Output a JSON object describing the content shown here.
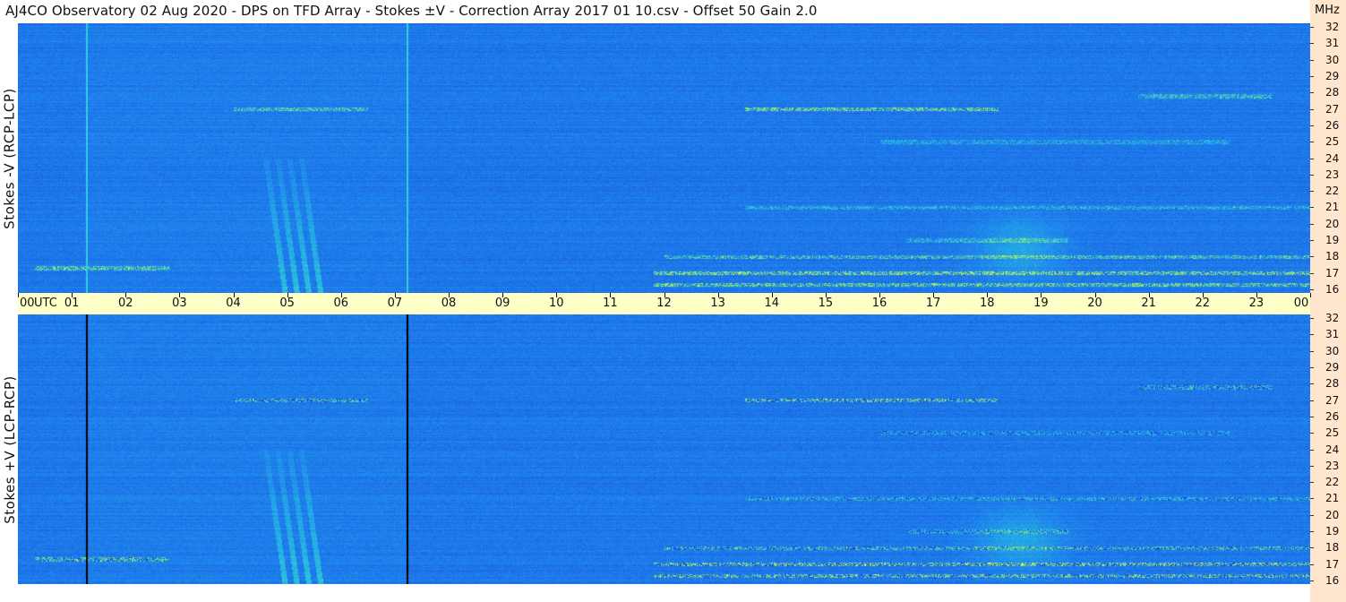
{
  "title": "AJ4CO Observatory  02 Aug 2020  -  DPS on TFD Array  -  Stokes ±V  -  Correction Array 2017 01 10.csv  -  Offset 50  Gain 2.0",
  "axis": {
    "utc_label": "UTC",
    "mhz_label": "MHz"
  },
  "panels": [
    {
      "ylabel": "Stokes -V (RCP-LCP)"
    },
    {
      "ylabel": "Stokes +V (LCP-RCP)"
    }
  ],
  "chart_data": [
    {
      "type": "heatmap",
      "title": "AJ4CO Observatory  02 Aug 2020  -  DPS on TFD Array  -  Stokes ±V  -  Correction Array 2017 01 10.csv  -  Offset 50  Gain 2.0",
      "ylabel": "Stokes -V (RCP-LCP)",
      "xlabel": "UTC",
      "x_ticks": [
        "00",
        "01",
        "02",
        "03",
        "04",
        "05",
        "06",
        "07",
        "08",
        "09",
        "10",
        "11",
        "12",
        "13",
        "14",
        "15",
        "16",
        "17",
        "18",
        "19",
        "20",
        "21",
        "22",
        "23",
        "00"
      ],
      "xlim": [
        0,
        24
      ],
      "y_unit": "MHz",
      "y_ticks": [
        16,
        17,
        18,
        19,
        20,
        21,
        22,
        23,
        24,
        25,
        26,
        27,
        28,
        29,
        30,
        31,
        32
      ],
      "ylim": [
        16,
        32
      ],
      "colormap": [
        "#1a3fcc",
        "#1e7fee",
        "#28c0e0",
        "#a0f060",
        "#f0f040"
      ]
    },
    {
      "type": "heatmap",
      "ylabel": "Stokes +V (LCP-RCP)",
      "xlabel": "UTC",
      "x_ticks": [
        "00",
        "01",
        "02",
        "03",
        "04",
        "05",
        "06",
        "07",
        "08",
        "09",
        "10",
        "11",
        "12",
        "13",
        "14",
        "15",
        "16",
        "17",
        "18",
        "19",
        "20",
        "21",
        "22",
        "23",
        "00"
      ],
      "xlim": [
        0,
        24
      ],
      "y_unit": "MHz",
      "y_ticks": [
        16,
        17,
        18,
        19,
        20,
        21,
        22,
        23,
        24,
        25,
        26,
        27,
        28,
        29,
        30,
        31,
        32
      ],
      "ylim": [
        16,
        32
      ],
      "colormap": [
        "#1a3fcc",
        "#1e7fee",
        "#28c0e0",
        "#a0f060",
        "#f0f040"
      ]
    }
  ]
}
